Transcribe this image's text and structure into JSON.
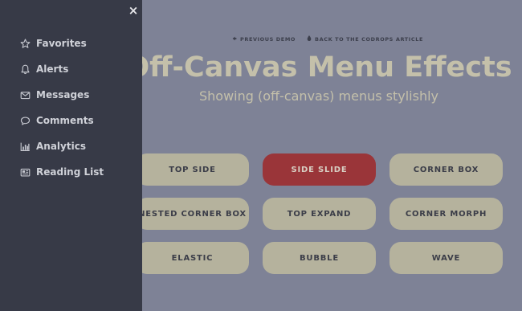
{
  "sidebar": {
    "close_label": "×",
    "items": [
      {
        "label": "Favorites",
        "icon": "star-icon"
      },
      {
        "label": "Alerts",
        "icon": "bell-icon"
      },
      {
        "label": "Messages",
        "icon": "envelope-icon"
      },
      {
        "label": "Comments",
        "icon": "comment-icon"
      },
      {
        "label": "Analytics",
        "icon": "bar-chart-icon"
      },
      {
        "label": "Reading List",
        "icon": "newspaper-icon"
      }
    ]
  },
  "header": {
    "prev_demo": "PREVIOUS DEMO",
    "back_article": "BACK TO THE CODROPS ARTICLE",
    "title": "Off-Canvas Menu Effects",
    "subtitle": "Showing (off-canvas) menus stylishly"
  },
  "buttons": [
    {
      "label": "TOP SIDE",
      "active": false
    },
    {
      "label": "SIDE SLIDE",
      "active": true
    },
    {
      "label": "CORNER BOX",
      "active": false
    },
    {
      "label": "NESTED CORNER BOX",
      "active": false
    },
    {
      "label": "TOP EXPAND",
      "active": false
    },
    {
      "label": "CORNER MORPH",
      "active": false
    },
    {
      "label": "ELASTIC",
      "active": false
    },
    {
      "label": "BUBBLE",
      "active": false
    },
    {
      "label": "WAVE",
      "active": false
    }
  ],
  "colors": {
    "background": "#7e8296",
    "sidebar": "#373a47",
    "button": "#b5b29d",
    "button_active": "#9a3539",
    "title": "#c4c0aa"
  }
}
